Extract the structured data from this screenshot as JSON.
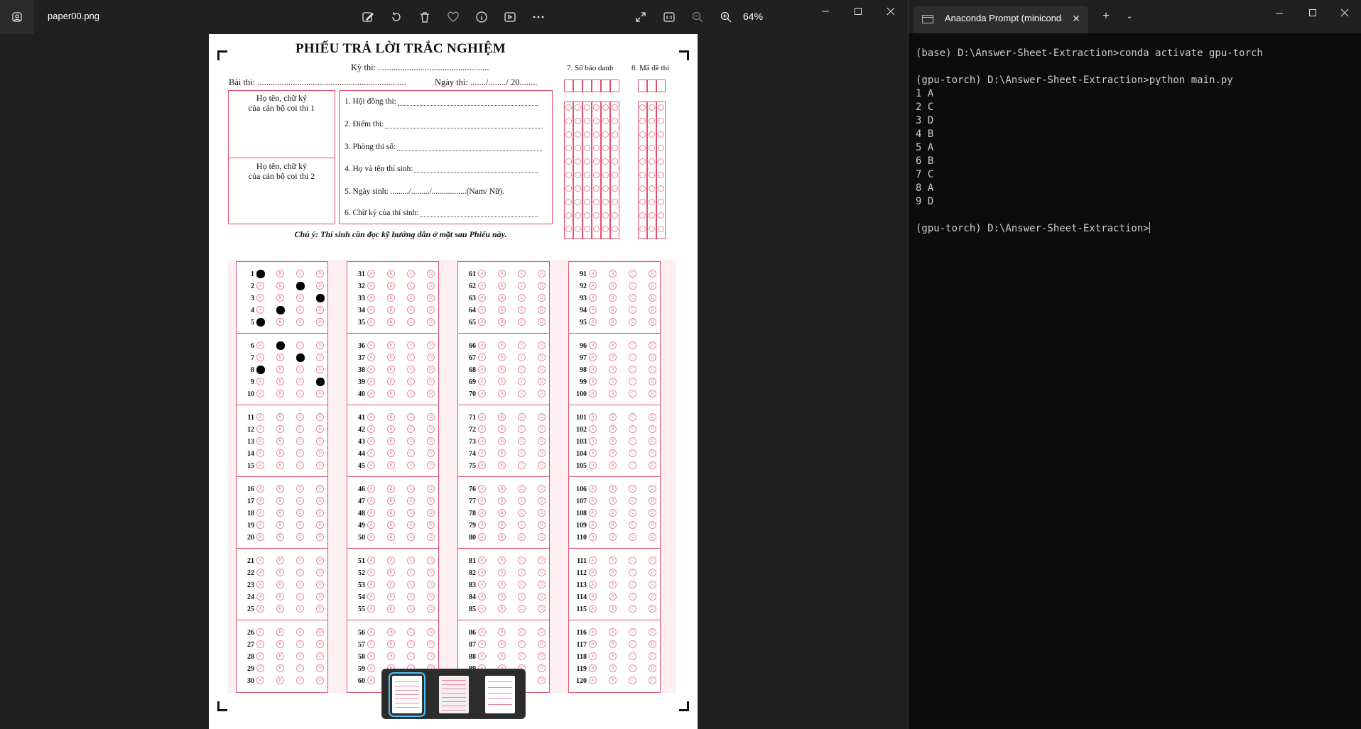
{
  "viewer": {
    "file_name": "paper00.png",
    "zoom_label": "64%",
    "toolbar_icons": [
      "edit-image-icon",
      "rotate-icon",
      "delete-icon",
      "favorite-icon",
      "info-icon",
      "slideshow-icon",
      "more-icon",
      "fullscreen-icon",
      "actual-size-icon",
      "zoom-out-icon",
      "zoom-in-icon"
    ]
  },
  "sheet": {
    "title": "PHIẾU TRẢ LỜI TRẮC NGHIỆM",
    "ky_thi": "Kỳ thi: ..................................................",
    "bai_thi": "Bài thi: ...................................................................",
    "ngay_thi": "Ngày thi: ......./......../ 20........",
    "signer1": [
      "Họ tên, chữ ký",
      "của cán bộ coi thi 1"
    ],
    "signer2": [
      "Họ tên, chữ ký",
      "của cán bộ coi thi 2"
    ],
    "info_rows": [
      "1. Hội đồng thi:",
      "2. Điểm thi:",
      "3. Phòng thi số:",
      "4. Họ và tên thí sinh:",
      "5. Ngày sinh: ........./........./.................(Nam/ Nữ).",
      "6. Chữ ký của thí sinh:"
    ],
    "so_bao_danh_label": "7. Số báo danh",
    "ma_de_thi_label": "8. Mã đề thi",
    "note": "Chú ý: Thí sinh cần đọc kỹ hướng dẫn ở mặt sau Phiếu này.",
    "choices": [
      "A",
      "B",
      "C",
      "D"
    ],
    "filled_answers": {
      "1": "A",
      "2": "C",
      "3": "D",
      "4": "B",
      "5": "A",
      "6": "B",
      "7": "C",
      "8": "A",
      "9": "D"
    },
    "column_starts": [
      1,
      31,
      61,
      91
    ],
    "questions_per_column": 30
  },
  "thumbnails": {
    "count": 3,
    "selected_index": 0
  },
  "terminal": {
    "tab_title": "Anaconda Prompt (miniconda",
    "lines": [
      "(base) D:\\Answer-Sheet-Extraction>conda activate gpu-torch",
      "",
      "(gpu-torch) D:\\Answer-Sheet-Extraction>python main.py",
      "1 A",
      "2 C",
      "3 D",
      "4 B",
      "5 A",
      "6 B",
      "7 C",
      "8 A",
      "9 D",
      "",
      "(gpu-torch) D:\\Answer-Sheet-Extraction>"
    ]
  }
}
